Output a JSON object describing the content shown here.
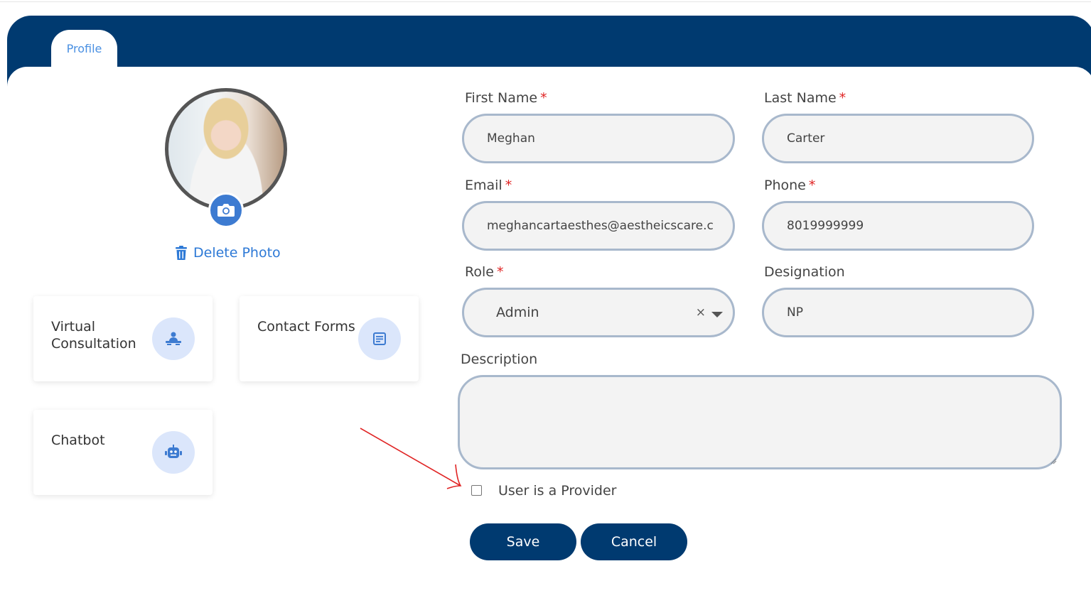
{
  "tabs": {
    "profile": "Profile"
  },
  "photo": {
    "delete_label": "Delete Photo"
  },
  "tiles": {
    "virtual_consultation": "Virtual Consultation",
    "contact_forms": "Contact Forms",
    "chatbot": "Chatbot"
  },
  "form": {
    "first_name": {
      "label": "First Name",
      "required": "*",
      "value": "Meghan"
    },
    "last_name": {
      "label": "Last Name",
      "required": "*",
      "value": "Carter"
    },
    "email": {
      "label": "Email",
      "required": "*",
      "value": "meghancartaesthes@aestheicscare.c"
    },
    "phone": {
      "label": "Phone",
      "required": "*",
      "value": "8019999999"
    },
    "role": {
      "label": "Role",
      "required": "*",
      "value": "Admin",
      "clear": "×"
    },
    "designation": {
      "label": "Designation",
      "value": "NP"
    },
    "description": {
      "label": "Description",
      "value": ""
    },
    "provider_checkbox": {
      "label": "User is a Provider",
      "checked": false
    }
  },
  "buttons": {
    "save": "Save",
    "cancel": "Cancel"
  },
  "colors": {
    "brand": "#003a70",
    "accent": "#2d79d6",
    "required": "#e02424",
    "annotation_arrow": "#e02424"
  },
  "icons": [
    "camera-icon",
    "trash-icon",
    "consultation-icon",
    "form-icon",
    "robot-icon",
    "chevron-down-icon",
    "clear-icon"
  ]
}
